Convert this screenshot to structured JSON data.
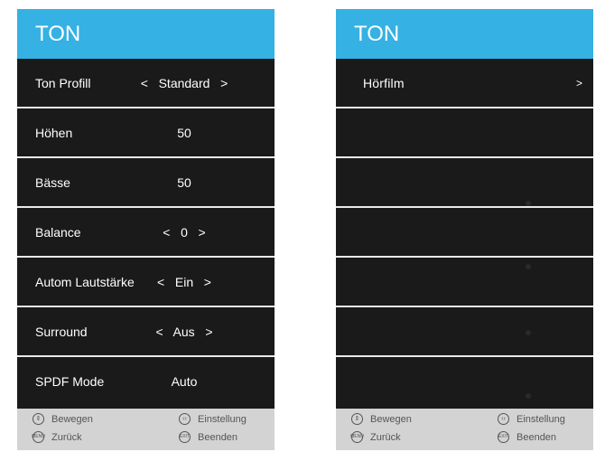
{
  "left_panel": {
    "title": "TON",
    "rows": [
      {
        "label": "Ton Profill",
        "value": "<   Standard   >"
      },
      {
        "label": "Höhen",
        "value": "50"
      },
      {
        "label": "Bässe",
        "value": "50"
      },
      {
        "label": "Balance",
        "value": "<   0   >"
      },
      {
        "label": "Autom Lautstärke",
        "value": "<   Ein   >"
      },
      {
        "label": "Surround",
        "value": "<   Aus   >"
      },
      {
        "label": "SPDF Mode",
        "value": "Auto"
      }
    ]
  },
  "right_panel": {
    "title": "TON",
    "rows": [
      {
        "label": "Hörfilm",
        "chevron": ">"
      }
    ]
  },
  "footer": {
    "move": "Bewegen",
    "adjust": "Einstellung",
    "back": "Zurück",
    "exit": "Beenden",
    "menu_icon_text": "MENU",
    "exit_icon_text": "EXIT"
  },
  "colors": {
    "header": "#35b1e4",
    "panel": "#1a1a1a",
    "footer": "#d3d3d3"
  },
  "icons": [
    "up-down-arrows-icon",
    "left-right-arrows-icon",
    "menu-button-icon",
    "exit-button-icon"
  ]
}
